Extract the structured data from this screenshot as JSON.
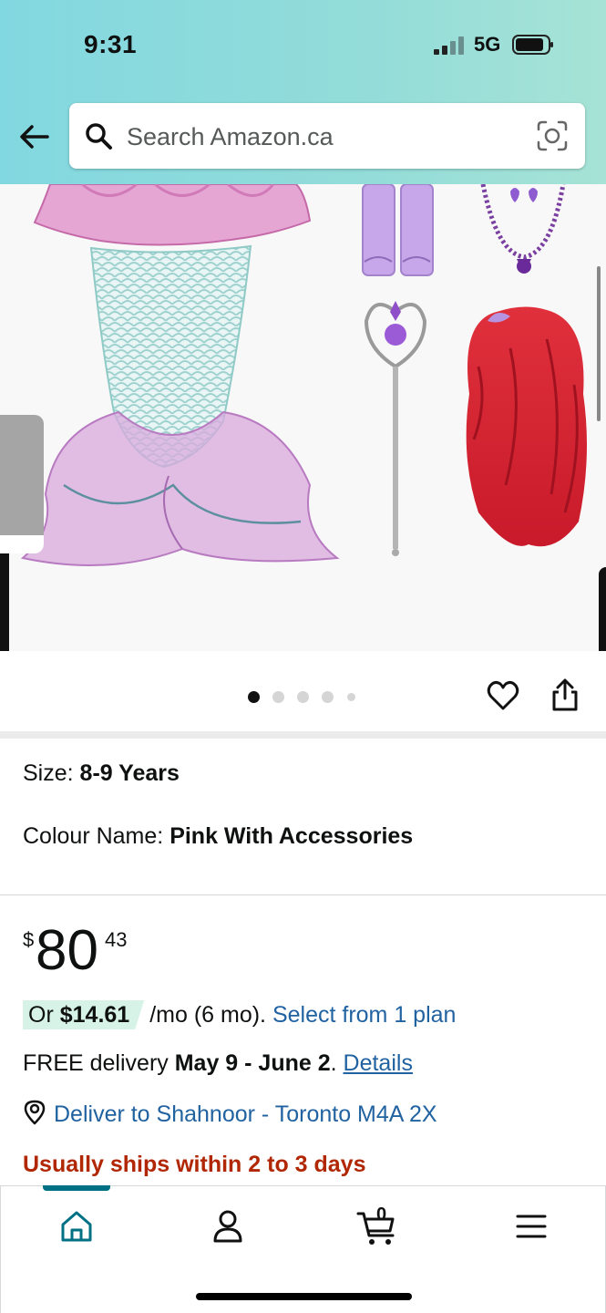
{
  "status_bar": {
    "time": "9:31",
    "network": "5G"
  },
  "search": {
    "placeholder": "Search Amazon.ca"
  },
  "image_carousel": {
    "dot_count": 5,
    "active_index": 0
  },
  "variations": {
    "size_label": "Size:",
    "size_value": "8-9 Years",
    "colour_label": "Colour Name:",
    "colour_value": "Pink With Accessories"
  },
  "price": {
    "symbol": "$",
    "whole": "80",
    "fraction": "43"
  },
  "installment": {
    "prefix": "Or",
    "amount": "$14.61",
    "terms": "/mo (6 mo).",
    "link": "Select from 1 plan"
  },
  "delivery": {
    "prefix": "FREE delivery",
    "dates": "May 9 - June 2",
    "suffix": ".",
    "details_link": "Details"
  },
  "deliver_to": {
    "text": "Deliver to Shahnoor - Toronto M4A 2X"
  },
  "availability": {
    "text": "Usually ships within 2 to 3 days"
  },
  "bottom_nav": {
    "items": [
      "home-icon",
      "account-icon",
      "cart-icon",
      "menu-icon"
    ],
    "cart_count": "0",
    "active": "home"
  },
  "colors": {
    "header_gradient": [
      "#82d8e0",
      "#a6e3d6"
    ],
    "link": "#2162a1",
    "availability_red": "#b12704",
    "nav_active": "#007185",
    "installment_badge": "#d7f3e8"
  }
}
